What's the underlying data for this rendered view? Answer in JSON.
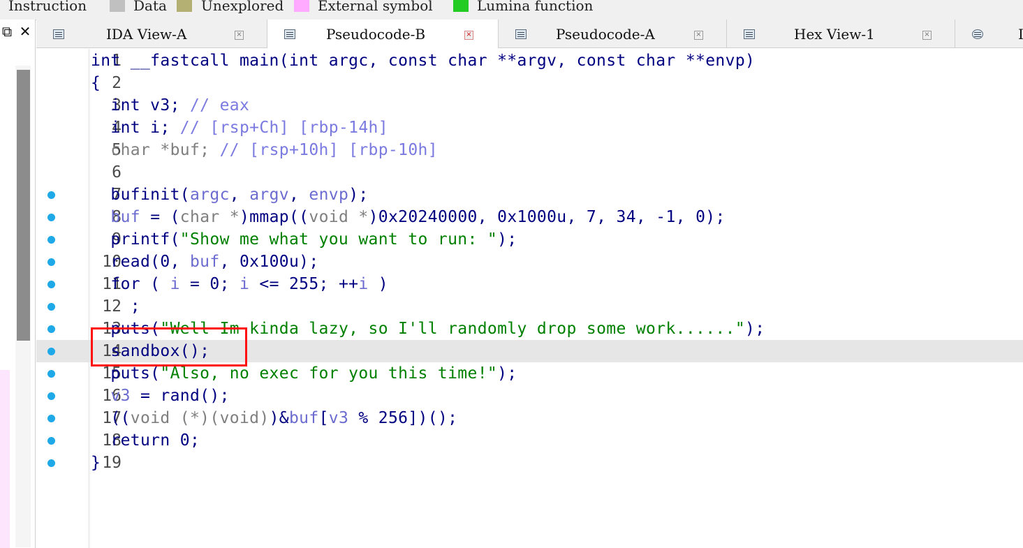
{
  "legend": [
    {
      "label": "Instruction",
      "color": "#c0c0c0"
    },
    {
      "label": "Data",
      "color": "#c0c0c0"
    },
    {
      "label": "Unexplored",
      "color": "#b4b074"
    },
    {
      "label": "External symbol",
      "color": "#ffaaff"
    },
    {
      "label": "Lumina function",
      "color": "#22cc22"
    }
  ],
  "left_tools": {
    "restore_icon": "restore-window-icon",
    "close_icon": "close-icon"
  },
  "tabs": [
    {
      "label": "IDA View-A",
      "icon": "disassembly-view-icon",
      "active": false
    },
    {
      "label": "Pseudocode-B",
      "icon": "pseudocode-view-icon",
      "active": true
    },
    {
      "label": "Pseudocode-A",
      "icon": "pseudocode-view-icon",
      "active": false
    },
    {
      "label": "Hex View-1",
      "icon": "hex-view-icon",
      "active": false
    },
    {
      "label": "I",
      "icon": "info-icon",
      "active": false
    }
  ],
  "code": {
    "highlighted_line": 14,
    "lines": [
      {
        "n": "1",
        "dot": false
      },
      {
        "n": "2",
        "dot": false
      },
      {
        "n": "3",
        "dot": false
      },
      {
        "n": "4",
        "dot": false
      },
      {
        "n": "5",
        "dot": false
      },
      {
        "n": "6",
        "dot": false
      },
      {
        "n": "7",
        "dot": true
      },
      {
        "n": "8",
        "dot": true
      },
      {
        "n": "9",
        "dot": true
      },
      {
        "n": "10",
        "dot": true
      },
      {
        "n": "11",
        "dot": true
      },
      {
        "n": "12",
        "dot": true
      },
      {
        "n": "13",
        "dot": true
      },
      {
        "n": "14",
        "dot": true
      },
      {
        "n": "15",
        "dot": true
      },
      {
        "n": "16",
        "dot": true
      },
      {
        "n": "17",
        "dot": true
      },
      {
        "n": "18",
        "dot": true
      },
      {
        "n": "19",
        "dot": true
      }
    ],
    "t": {
      "l1": "int __fastcall main(int argc, const char **argv, const char **envp)",
      "l2": "{",
      "l3a": "  int v3; ",
      "l3b": "// eax",
      "l4a": "  int i; ",
      "l4b": "// [rsp+Ch] [rbp-14h]",
      "l5a": "  char *buf; ",
      "l5b": "// [rsp+10h] [rbp-10h]",
      "l7a": "  bufinit(",
      "l7b": "argc",
      "l7c": ", ",
      "l7d": "argv",
      "l7e": ", ",
      "l7f": "envp",
      "l7g": ");",
      "l8a": "  ",
      "l8b": "buf",
      "l8c": " = (",
      "l8d": "char *",
      "l8e": ")mmap((",
      "l8f": "void *",
      "l8g": ")0x20240000, 0x1000u, 7, 34, -1, 0);",
      "l9a": "  printf(",
      "l9b": "\"Show me what you want to run: \"",
      "l9c": ");",
      "l10a": "  read(0, ",
      "l10b": "buf",
      "l10c": ", 0x100u);",
      "l11a": "  for ( ",
      "l11b": "i",
      "l11c": " = 0; ",
      "l11d": "i",
      "l11e": " <= 255; ++",
      "l11f": "i",
      "l11g": " )",
      "l12": "    ;",
      "l13a": "  puts(",
      "l13b": "\"Well Im kinda lazy, so I'll randomly drop some work......\"",
      "l13c": ");",
      "l14": "  sandbox();",
      "l15a": "  puts(",
      "l15b": "\"Also, no exec for you this time!\"",
      "l15c": ");",
      "l16a": "  ",
      "l16b": "v3",
      "l16c": " = rand();",
      "l17a": "  ((",
      "l17b": "void (*)(void)",
      "l17c": ")&",
      "l17d": "buf",
      "l17e": "[",
      "l17f": "v3",
      "l17g": " % 256])();",
      "l18": "  return 0;",
      "l19": "}"
    }
  },
  "colors": {
    "highlight_line": "#e6e6e6",
    "annotation_box": "#ff1010",
    "breakpoint_dot": "#1fa9e8"
  }
}
